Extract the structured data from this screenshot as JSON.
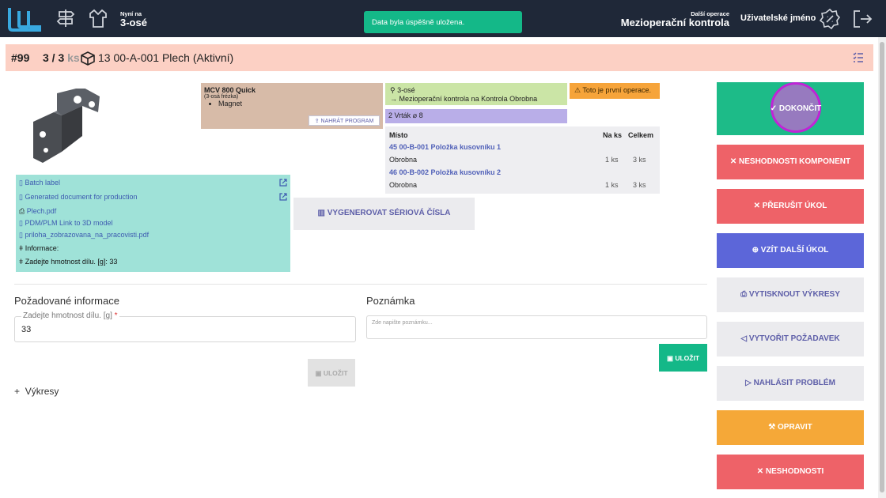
{
  "topbar": {
    "now_at_small": "Nyní na",
    "now_at_big": "3-osé",
    "toast": "Data byla úspěšně uložena.",
    "next_op_small": "Další operace",
    "next_op_big": "Mezioperační kontrola",
    "username": "Uživatelské jméno"
  },
  "header": {
    "job_number": "#99",
    "quantity": "3 / 3",
    "quantity_unit": "ks",
    "part_title": "13 00-A-001 Plech (Aktivní)"
  },
  "machine": {
    "name": "MCV 800 Quick",
    "type": "(3-osá frézka)",
    "items": [
      "Magnet"
    ],
    "upload_label": "NAHRÁT PROGRAM"
  },
  "operation": {
    "name": "3-osé",
    "next": "Mezioperační kontrola na  Kontrola Obrobna",
    "warning": "Toto je první operace.",
    "tool": "2 Vrták ⌀ 8"
  },
  "bom": {
    "headers": {
      "place": "Místo",
      "per_unit": "Na ks",
      "total": "Celkem"
    },
    "rows": [
      {
        "item": "45 00-B-001 Položka kusovníku 1",
        "place": "Obrobna",
        "per_unit": "1 ks",
        "total": "3 ks"
      },
      {
        "item": "46 00-B-002 Položka kusovníku 2",
        "place": "Obrobna",
        "per_unit": "1 ks",
        "total": "3 ks"
      }
    ]
  },
  "documents": {
    "batch_label": "Batch label",
    "generated": "Generated document for production",
    "files": [
      "Plech.pdf",
      "PDM/PLM Link to 3D model",
      "priloha_zobrazovana_na_pracovisti.pdf"
    ],
    "info_label": "Informace:",
    "info_value": "Zadejte hmotnost dílu. [g]: 33"
  },
  "serial_button": "VYGENEROVAT SÉRIOVÁ ČÍSLA",
  "required_info": {
    "title": "Požadované informace",
    "field_label": "Zadejte hmotnost dílu. [g]",
    "required_mark": "*",
    "field_value": "33",
    "save_label": "ULOŽIT"
  },
  "note": {
    "title": "Poznámka",
    "placeholder": "Zde napište poznámku...",
    "save_label": "ULOŽIT"
  },
  "drawings_label": "Výkresy",
  "actions": {
    "complete": "DOKONČIT",
    "component_nc": "NESHODNOSTI KOMPONENT",
    "interrupt": "PŘERUŠIT ÚKOL",
    "take_next": "VZÍT DALŠÍ ÚKOL",
    "print": "VYTISKNOUT VÝKRESY",
    "request": "VYTVOŘIT POŽADAVEK",
    "report": "NAHLÁSIT PROBLÉM",
    "repair": "OPRAVIT",
    "nonconformity": "NESHODNOSTI"
  },
  "colors": {
    "topbar": "#1f2838",
    "accent_green": "#1dbb88",
    "accent_red": "#ee6268",
    "accent_blue": "#5c66d9",
    "accent_orange": "#f5a838",
    "header_band": "#fcd0c4"
  }
}
